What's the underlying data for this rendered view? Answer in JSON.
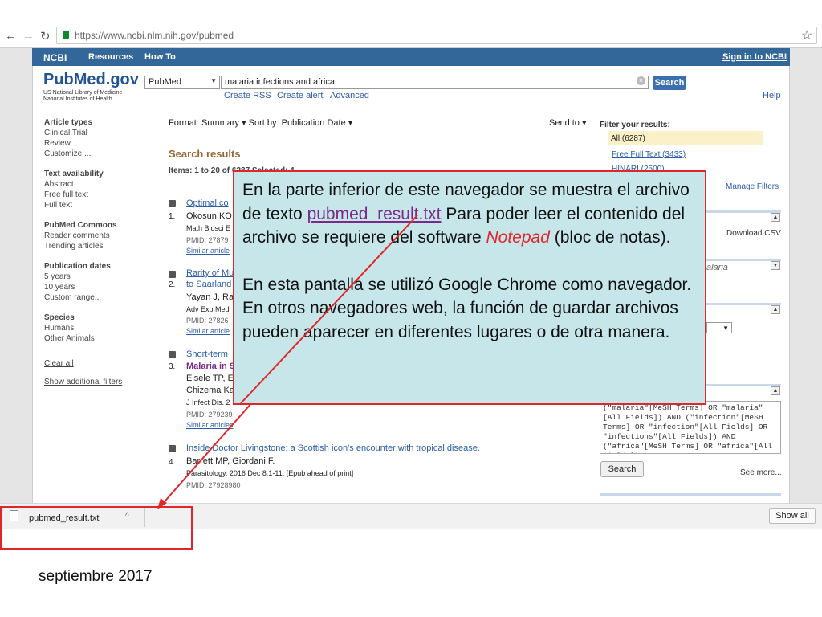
{
  "browser": {
    "url": "https://www.ncbi.nlm.nih.gov/pubmed"
  },
  "ncbi": {
    "brand": "NCBI",
    "resources": "Resources",
    "howto": "How To",
    "signin": "Sign in to NCBI"
  },
  "logo": {
    "pub": "PubMed.gov",
    "sub1": "US National Library of Medicine",
    "sub2": "National Institutes of Health"
  },
  "search": {
    "db": "PubMed",
    "query": "malaria infections and africa",
    "button": "Search",
    "links": [
      "Create RSS",
      "Create alert",
      "Advanced"
    ],
    "help": "Help"
  },
  "sidebar": {
    "article_types": {
      "header": "Article types",
      "items": [
        "Clinical Trial",
        "Review",
        "Customize ..."
      ]
    },
    "text_availability": {
      "header": "Text availability",
      "items": [
        "Abstract",
        "Free full text",
        "Full text"
      ]
    },
    "commons": {
      "header": "PubMed Commons",
      "items": [
        "Reader comments",
        "Trending articles"
      ]
    },
    "pub_dates": {
      "header": "Publication dates",
      "items": [
        "5 years",
        "10 years",
        "Custom range..."
      ]
    },
    "species": {
      "header": "Species",
      "items": [
        "Humans",
        "Other Animals"
      ]
    },
    "clear_all": "Clear all",
    "show_filters": "Show additional filters"
  },
  "results": {
    "format": "Format: Summary ▾   Sort by: Publication Date ▾",
    "send_to": "Send to ▾",
    "heading": "Search results",
    "items_label": "Items: 1 to 20 of 6287    Selected: 4",
    "list": [
      {
        "num": "1.",
        "title": "Optimal co",
        "authors": "Okosun KO",
        "journal": "Math Biosci E",
        "pmid": "PMID: 27879",
        "similar": "Similar article"
      },
      {
        "num": "2.",
        "title": "Rarity of Mu",
        "title2": "to Saarland",
        "authors": "Yayan J, Ra",
        "journal": "Adv Exp Med",
        "pmid": "PMID: 27826",
        "similar": "Similar article"
      },
      {
        "num": "3.",
        "title": "Short-term",
        "title2": "Malaria in S",
        "authors": "Eisele TP, E",
        "authors2": "Chizema Ka",
        "journal": "J Infect Dis. 2",
        "pmid": "PMID: 279239",
        "similar": "Similar articles"
      },
      {
        "num": "4.",
        "title": "Inside Doctor Livingstone: a Scottish icon's encounter with tropical disease.",
        "authors": "Barrett MP, Giordani F.",
        "journal": "Parasitology. 2016 Dec 8:1-11. [Epub ahead of print]",
        "pmid": "PMID: 27928980"
      }
    ]
  },
  "filters": {
    "header": "Filter your results:",
    "all": "All (6287)",
    "free_full": "Free Full Text (3433)",
    "hinari": "HINARI (2500)",
    "manage": "Manage Filters",
    "download_csv": "Download CSV",
    "alaria": "alaria",
    "query": "(\"malaria\"[MeSH Terms] OR \"malaria\"[All Fields]) AND (\"infection\"[MeSH Terms] OR \"infection\"[All Fields] OR \"infections\"[All Fields]) AND (\"africa\"[MeSH Terms] OR \"africa\"[All Fields])",
    "search_btn": "Search",
    "see_more": "See more..."
  },
  "download": {
    "filename": "pubmed_result.txt",
    "show_all": "Show all"
  },
  "callout": {
    "p1a": "En la parte inferior de este navegador se muestra el archivo de texto ",
    "p1link": "pubmed_result.txt",
    "p1b": "   Para poder leer el contenido del archivo se requiere del software ",
    "p1np": "Notepad",
    "p1c": " (bloc de notas).",
    "p2": "En esta pantalla se utilizó Google Chrome como navegador. En otros navegadores web, la función de guardar archivos pueden aparecer en diferentes lugares o de otra manera."
  },
  "footer": "septiembre 2017",
  "colors": {
    "ncbi_bar": "#336699",
    "callout_bg": "#c6e6ea",
    "red": "#e0262a"
  }
}
